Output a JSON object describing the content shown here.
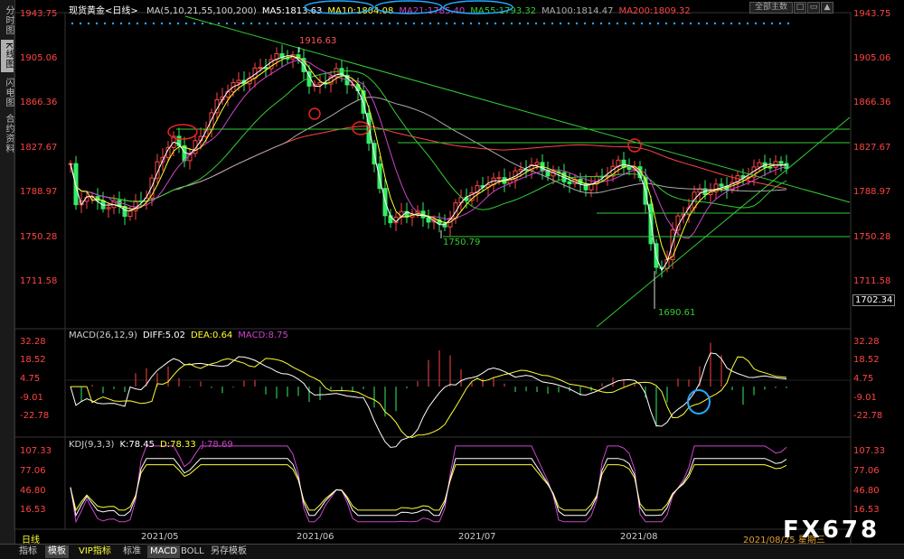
{
  "app": {
    "instrument_label": "现货黄金<日线>",
    "menu_button": "全部主数",
    "arrow_up": "▲"
  },
  "sidebar": {
    "tabs": [
      {
        "label": "分时图",
        "active": false
      },
      {
        "label": "K线图",
        "active": true
      },
      {
        "label": "闪电图",
        "active": false
      },
      {
        "label": "合约资料",
        "active": false
      }
    ]
  },
  "main_panel": {
    "legend": [
      {
        "text": "MA(5,10,21,55,100,200)",
        "color": "#d0d0d0"
      },
      {
        "text": "MA5:1813.63",
        "color": "#ffffff"
      },
      {
        "text": "MA10:1804.08",
        "color": "#ffff33"
      },
      {
        "text": "MA21:1785.40",
        "color": "#cc44cc"
      },
      {
        "text": "MA55:1793.32",
        "color": "#33cc33"
      },
      {
        "text": "MA100:1814.47",
        "color": "#aaaaaa"
      },
      {
        "text": "MA200:1809.32",
        "color": "#ff4444"
      }
    ],
    "price_ticks": [
      "1943.75",
      "1905.06",
      "1866.36",
      "1827.67",
      "1788.97",
      "1750.28",
      "1711.58"
    ],
    "current_price": "1702.34",
    "annotations": {
      "high": "1916.63",
      "low1": "1750.79",
      "low2": "1690.61"
    },
    "ma_colors": {
      "ma5": "#ffffff",
      "ma10": "#ffff33",
      "ma21": "#cc44cc",
      "ma55": "#33cc33",
      "ma100": "#aaaaaa",
      "ma200": "#ff4444",
      "up": "#ff4444",
      "down": "#33ee66"
    }
  },
  "macd_panel": {
    "legend": [
      {
        "text": "MACD(26,12,9)",
        "color": "#d0d0d0"
      },
      {
        "text": "DIFF:5.02",
        "color": "#ffffff"
      },
      {
        "text": "DEA:0.64",
        "color": "#ffff33"
      },
      {
        "text": "MACD:8.75",
        "color": "#cc44cc"
      }
    ],
    "ticks": [
      "32.28",
      "18.52",
      "4.75",
      "-9.01",
      "-22.78"
    ]
  },
  "kdj_panel": {
    "legend": [
      {
        "text": "KDJ(9,3,3)",
        "color": "#d0d0d0"
      },
      {
        "text": "K:78.45",
        "color": "#ffffff"
      },
      {
        "text": "D:78.33",
        "color": "#ffff33"
      },
      {
        "text": "J:78.69",
        "color": "#cc44cc"
      }
    ],
    "ticks": [
      "107.33",
      "77.06",
      "46.80",
      "16.53"
    ]
  },
  "x_axis": {
    "period_label": "日线",
    "months": [
      "2021/05",
      "2021/06",
      "2021/07",
      "2021/08"
    ],
    "current_date": "2021/08/25 星期三"
  },
  "watermark": "FX678",
  "bottom_tabs": [
    {
      "label": "指标",
      "active": false
    },
    {
      "label": "模板",
      "active": true
    },
    {
      "label": "VIP指标",
      "active": false
    },
    {
      "label": "标准",
      "active": false
    },
    {
      "label": "MACD",
      "active": true
    },
    {
      "label": "BOLL",
      "active": false
    },
    {
      "label": "另存模板",
      "active": false
    }
  ]
}
